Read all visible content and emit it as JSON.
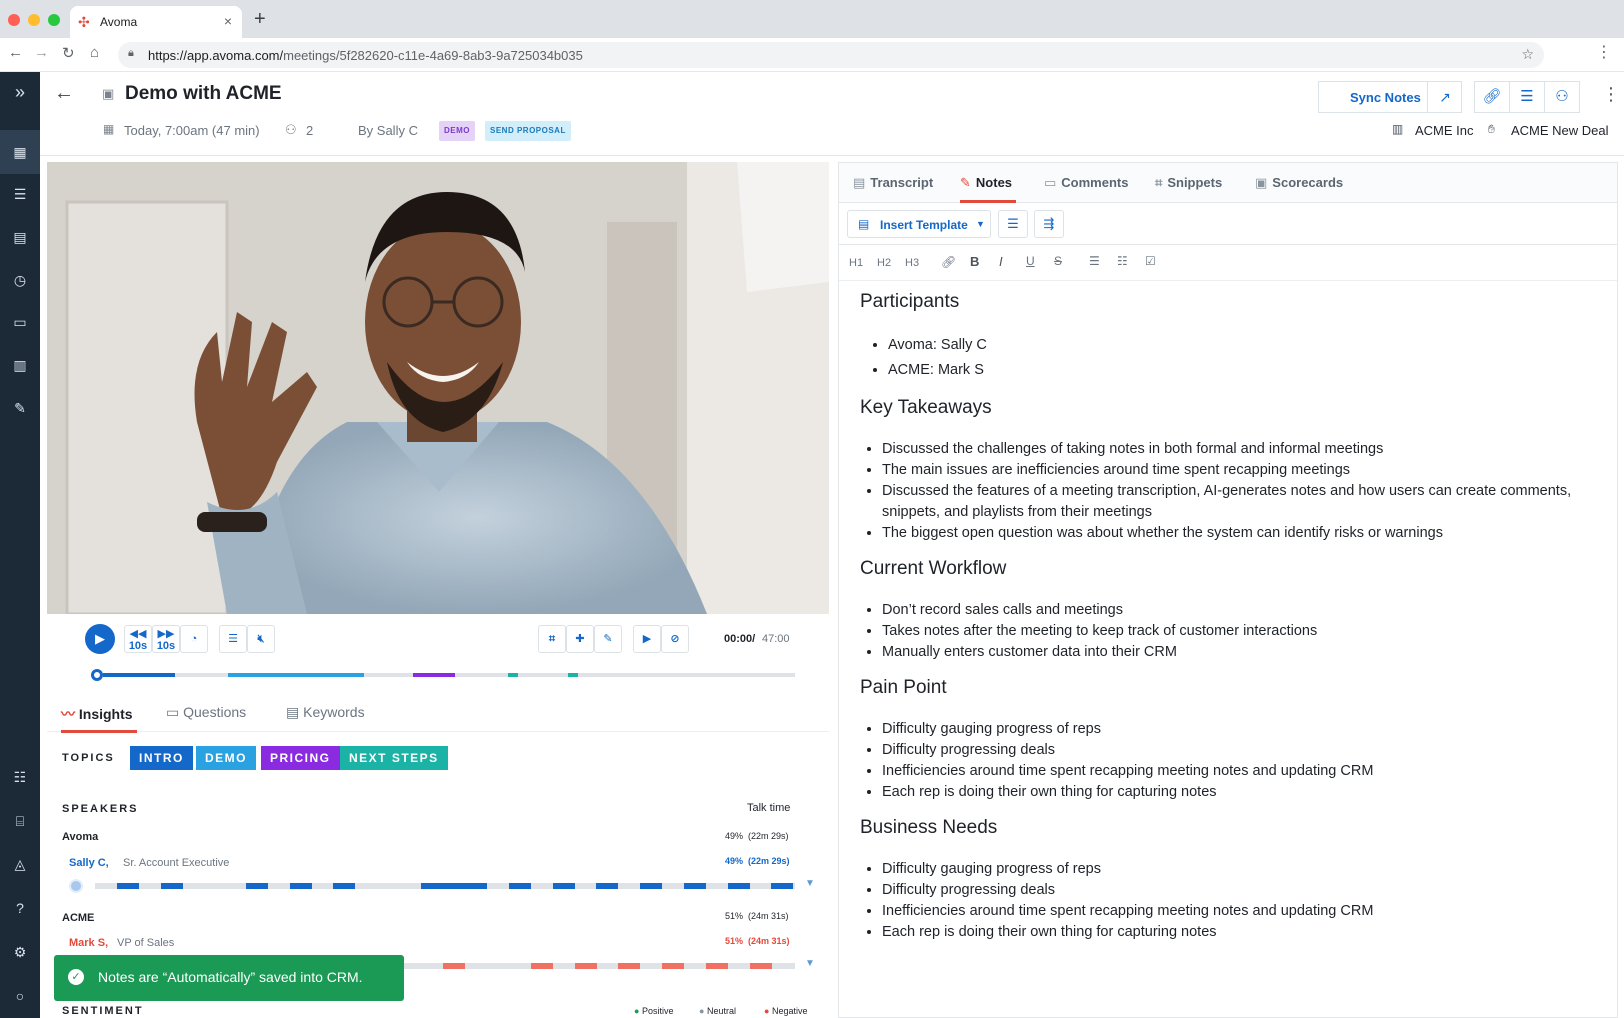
{
  "browser": {
    "tab_title": "Avoma",
    "url_host": "https://app.avoma.com/",
    "url_path": "meetings/5f282620-c11e-4a69-8ab3-9a725034b035"
  },
  "meeting": {
    "title": "Demo with ACME",
    "date": "Today, 7:00am (47 min)",
    "attendees": "2",
    "by": "By Sally C",
    "tags": [
      "DEMO",
      "SEND PROPOSAL"
    ],
    "sync_notes_label": "Sync Notes",
    "account": "ACME Inc",
    "deal": "ACME New Deal"
  },
  "player": {
    "current_time": "00:00/",
    "total_time": "47:00",
    "skip_back": "10s",
    "skip_forward": "10s"
  },
  "insights_tabs": [
    "Insights",
    "Questions",
    "Keywords"
  ],
  "topics": {
    "label": "TOPICS",
    "items": [
      "INTRO",
      "DEMO",
      "PRICING",
      "NEXT STEPS"
    ]
  },
  "speakers": {
    "label": "SPEAKERS",
    "talk_time_label": "Talk time",
    "groups": [
      {
        "company": "Avoma",
        "company_stat": "49%  (22m 29s)",
        "name": "Sally C,",
        "role": "Sr. Account Executive",
        "stat": "49%  (22m 29s)"
      },
      {
        "company": "ACME",
        "company_stat": "51%  (24m 31s)",
        "name": "Mark S,",
        "role": "VP of Sales",
        "stat": "51%  (24m 31s)"
      }
    ]
  },
  "sentiment": {
    "label": "SENTIMENT",
    "legend": [
      "Positive",
      "Neutral",
      "Negative"
    ]
  },
  "toast": "Notes are “Automatically” saved into CRM.",
  "right_tabs": [
    "Transcript",
    "Notes",
    "Comments",
    "Snippets",
    "Scorecards"
  ],
  "editor": {
    "insert_template": "Insert Template",
    "format_buttons": [
      "H1",
      "H2",
      "H3"
    ]
  },
  "notes": [
    {
      "heading": "Participants",
      "items": [
        "Avoma: Sally C",
        "ACME: Mark S"
      ]
    },
    {
      "heading": "Key Takeaways",
      "items": [
        "Discussed the challenges of taking notes in both formal and informal meetings",
        "The main issues are inefficiencies around time spent recapping meetings",
        "Discussed the features of a meeting transcription, AI-generates notes and how users can create comments, snippets, and playlists from their meetings",
        "The biggest open question was about whether the system can identify risks or warnings"
      ]
    },
    {
      "heading": "Current Workflow",
      "items": [
        "Don’t record sales calls and meetings",
        "Takes notes after the meeting to keep track of customer interactions",
        "Manually enters customer data into their CRM"
      ]
    },
    {
      "heading": "Pain Point",
      "items": [
        "Difficulty gauging progress of reps",
        "Difficulty progressing deals",
        "Inefficiencies around time spent recapping meeting notes and updating CRM",
        "Each rep is doing their own thing for capturing notes"
      ]
    },
    {
      "heading": "Business Needs",
      "items": [
        "Difficulty gauging progress of reps",
        "Difficulty progressing deals",
        "Inefficiencies around time spent recapping meeting notes and updating CRM",
        "Each rep is doing their own thing for capturing notes"
      ]
    }
  ],
  "colors": {
    "accent": "#1468c9",
    "sidebar": "#1c2a38",
    "intro": "#1468c9",
    "demo": "#2aa1e0",
    "pricing": "#8a2be2",
    "next_steps": "#1ab3a6",
    "acme_talk": "#f07062",
    "toast": "#1a9a55"
  }
}
